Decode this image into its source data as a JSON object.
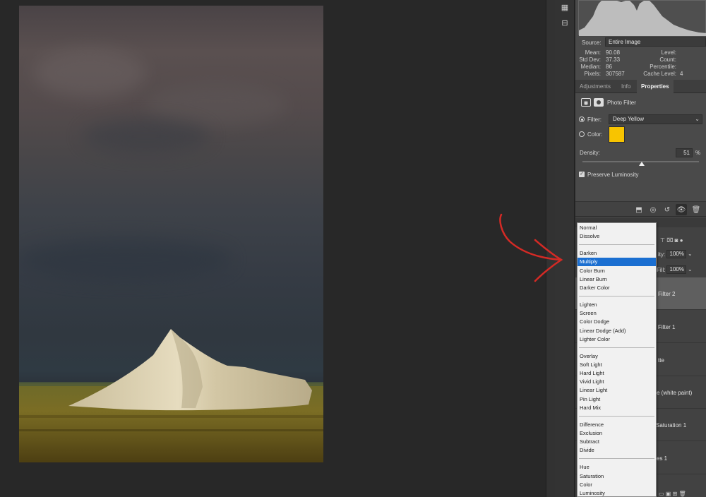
{
  "histogram": {
    "source_label": "Source:",
    "source_value": "Entire Image",
    "stats_left": [
      {
        "label": "Mean:",
        "value": "90.08"
      },
      {
        "label": "Std Dev:",
        "value": "37.33"
      },
      {
        "label": "Median:",
        "value": "86"
      },
      {
        "label": "Pixels:",
        "value": "307587"
      }
    ],
    "stats_right": [
      {
        "label": "Level:",
        "value": ""
      },
      {
        "label": "Count:",
        "value": ""
      },
      {
        "label": "Percentile:",
        "value": ""
      },
      {
        "label": "Cache Level:",
        "value": "4"
      }
    ]
  },
  "tabs": [
    "Adjustments",
    "Info",
    "Properties"
  ],
  "active_tab": "Properties",
  "properties": {
    "title": "Photo Filter",
    "filter_label": "Filter:",
    "filter_value": "Deep Yellow",
    "color_label": "Color:",
    "color_hex": "#f8c400",
    "density_label": "Density:",
    "density_value": "51",
    "density_unit": "%",
    "density_fraction": 0.51,
    "preserve_label": "Preserve Luminosity",
    "preserve_checked": true
  },
  "layers": {
    "opacity_label": "ity:",
    "opacity_value": "100%",
    "fill_label": "Fill:",
    "fill_value": "100%",
    "names": [
      "Filter 2",
      "Filter 1",
      "tte",
      "e (white paint)",
      "Saturation 1",
      "es 1"
    ]
  },
  "blend_dropdown": {
    "groups": [
      [
        "Normal",
        "Dissolve"
      ],
      [
        "Darken",
        "Multiply",
        "Color Burn",
        "Linear Burn",
        "Darker Color"
      ],
      [
        "Lighten",
        "Screen",
        "Color Dodge",
        "Linear Dodge (Add)",
        "Lighter Color"
      ],
      [
        "Overlay",
        "Soft Light",
        "Hard Light",
        "Vivid Light",
        "Linear Light",
        "Pin Light",
        "Hard Mix"
      ],
      [
        "Difference",
        "Exclusion",
        "Subtract",
        "Divide"
      ],
      [
        "Hue",
        "Saturation",
        "Color",
        "Luminosity"
      ]
    ],
    "highlighted": "Multiply"
  },
  "colors": {
    "annotation_arrow": "#d42a25",
    "highlight": "#1b6fd1"
  }
}
